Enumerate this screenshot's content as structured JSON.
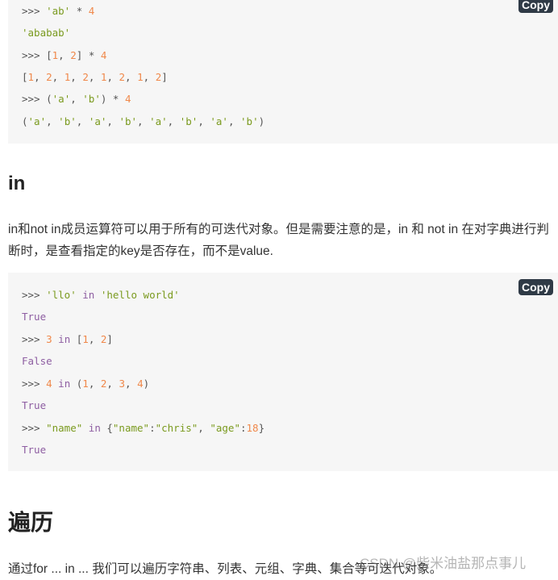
{
  "code_blocks": [
    {
      "copy_label": "Copy",
      "lines": [
        [
          [
            ">>> ",
            ""
          ],
          [
            "'ab'",
            "s"
          ],
          [
            " * ",
            ""
          ],
          [
            "4",
            "n"
          ]
        ],
        [
          [
            "'ababab'",
            "s"
          ]
        ],
        [
          [
            ">>> [",
            ""
          ],
          [
            "1",
            "n"
          ],
          [
            ", ",
            ""
          ],
          [
            "2",
            "n"
          ],
          [
            "] * ",
            ""
          ],
          [
            "4",
            "n"
          ]
        ],
        [
          [
            "[",
            ""
          ],
          [
            "1",
            "n"
          ],
          [
            ", ",
            ""
          ],
          [
            "2",
            "n"
          ],
          [
            ", ",
            ""
          ],
          [
            "1",
            "n"
          ],
          [
            ", ",
            ""
          ],
          [
            "2",
            "n"
          ],
          [
            ", ",
            ""
          ],
          [
            "1",
            "n"
          ],
          [
            ", ",
            ""
          ],
          [
            "2",
            "n"
          ],
          [
            ", ",
            ""
          ],
          [
            "1",
            "n"
          ],
          [
            ", ",
            ""
          ],
          [
            "2",
            "n"
          ],
          [
            "]",
            ""
          ]
        ],
        [
          [
            ">>> (",
            ""
          ],
          [
            "'a'",
            "s"
          ],
          [
            ", ",
            ""
          ],
          [
            "'b'",
            "s"
          ],
          [
            ") * ",
            ""
          ],
          [
            "4",
            "n"
          ]
        ],
        [
          [
            "(",
            ""
          ],
          [
            "'a'",
            "s"
          ],
          [
            ", ",
            ""
          ],
          [
            "'b'",
            "s"
          ],
          [
            ", ",
            ""
          ],
          [
            "'a'",
            "s"
          ],
          [
            ", ",
            ""
          ],
          [
            "'b'",
            "s"
          ],
          [
            ", ",
            ""
          ],
          [
            "'a'",
            "s"
          ],
          [
            ", ",
            ""
          ],
          [
            "'b'",
            "s"
          ],
          [
            ", ",
            ""
          ],
          [
            "'a'",
            "s"
          ],
          [
            ", ",
            ""
          ],
          [
            "'b'",
            "s"
          ],
          [
            ")",
            ""
          ]
        ]
      ]
    },
    {
      "copy_label": "Copy",
      "lines": [
        [
          [
            ">>> ",
            ""
          ],
          [
            "'llo'",
            "s"
          ],
          [
            " in ",
            "k"
          ],
          [
            "'hello world'",
            "s"
          ]
        ],
        [
          [
            "True",
            "k"
          ]
        ],
        [
          [
            ">>> ",
            ""
          ],
          [
            "3",
            "n"
          ],
          [
            " in ",
            "k"
          ],
          [
            "[",
            ""
          ],
          [
            "1",
            "n"
          ],
          [
            ", ",
            ""
          ],
          [
            "2",
            "n"
          ],
          [
            "]",
            ""
          ]
        ],
        [
          [
            "False",
            "k"
          ]
        ],
        [
          [
            ">>> ",
            ""
          ],
          [
            "4",
            "n"
          ],
          [
            " in ",
            "k"
          ],
          [
            "(",
            ""
          ],
          [
            "1",
            "n"
          ],
          [
            ", ",
            ""
          ],
          [
            "2",
            "n"
          ],
          [
            ", ",
            ""
          ],
          [
            "3",
            "n"
          ],
          [
            ", ",
            ""
          ],
          [
            "4",
            "n"
          ],
          [
            ")",
            ""
          ]
        ],
        [
          [
            "True",
            "k"
          ]
        ],
        [
          [
            ">>> ",
            ""
          ],
          [
            "\"name\"",
            "s"
          ],
          [
            " in ",
            "k"
          ],
          [
            "{",
            ""
          ],
          [
            "\"name\"",
            "s"
          ],
          [
            ":",
            ""
          ],
          [
            "\"chris\"",
            "s"
          ],
          [
            ", ",
            ""
          ],
          [
            "\"age\"",
            "s"
          ],
          [
            ":",
            ""
          ],
          [
            "18",
            "n"
          ],
          [
            "}",
            ""
          ]
        ],
        [
          [
            "True",
            "k"
          ]
        ]
      ]
    }
  ],
  "section_in": {
    "heading": "in",
    "paragraph": "in和not in成员运算符可以用于所有的可迭代对象。但是需要注意的是，in 和 not in 在对字典进行判断时，是查看指定的key是否存在，而不是value."
  },
  "section_traverse": {
    "heading": "遍历",
    "paragraph": "通过for ... in ... 我们可以遍历字符串、列表、元组、字典、集合等可迭代对象。"
  },
  "watermark": "CSDN @柴米油盐那点事儿"
}
